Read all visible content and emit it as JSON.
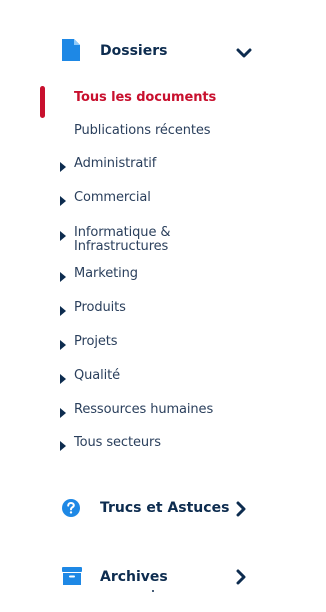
{
  "dossiers": {
    "title": "Dossiers",
    "links": {
      "all": "Tous les documents",
      "recent": "Publications récentes"
    },
    "categories": [
      "Administratif",
      "Commercial",
      "Informatique &",
      "Infrastructures",
      "Marketing",
      "Produits",
      "Projets",
      "Qualité",
      "Ressources humaines",
      "Tous secteurs"
    ]
  },
  "tips": {
    "title": "Trucs et Astuces"
  },
  "archives": {
    "title": "Archives"
  },
  "colors": {
    "accent": "#c8102e",
    "icon_blue": "#1e88e5",
    "text_dark": "#0d2c4f"
  }
}
